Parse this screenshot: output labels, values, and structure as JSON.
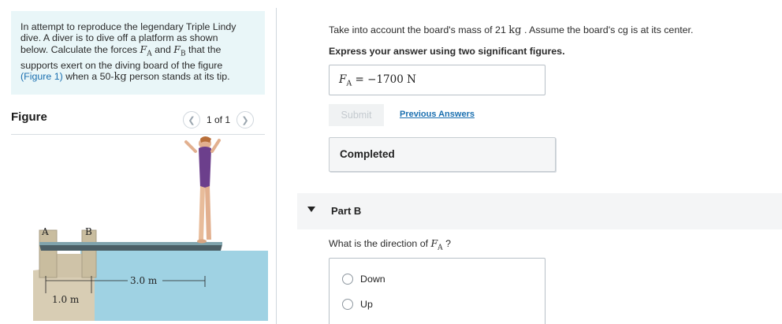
{
  "problem": {
    "line1": "In attempt to reproduce the legendary Triple Lindy",
    "line2": "dive.  A diver is to dive off a platform as shown",
    "line3a": "below.  Calculate the forces ",
    "fa": "F",
    "fa_sub": "A",
    "and": " and ",
    "fb": "F",
    "fb_sub": "B",
    "line3b": " that the",
    "line4": "supports exert on the diving board of the figure",
    "link_open": "(",
    "figure_link": "Figure 1",
    "link_close": ")",
    "line5a": " when a 50-",
    "kg": "kg",
    "line5b": " person stands at its tip."
  },
  "figure": {
    "title": "Figure",
    "pager_text": "1 of 1",
    "label_a": "A",
    "label_b": "B",
    "dim_long": "3.0 m",
    "dim_short": "1.0 m"
  },
  "partA": {
    "prompt_pre": "Take into account the board's mass of 21 ",
    "prompt_kg": "kg",
    "prompt_post": " . Assume the board's cg is at its center.",
    "instruction": "Express your answer using two significant figures.",
    "answer_lhs": "F",
    "answer_sub": "A",
    "answer_eq": " =  ",
    "answer_value": "−1700  N",
    "submit_label": "Submit",
    "prev_answers_label": "Previous Answers",
    "completed_label": "Completed"
  },
  "partB": {
    "label": "Part B",
    "question_pre": "What is the direction of ",
    "q_var": "F",
    "q_sub": "A",
    "question_post": " ?",
    "options": [
      "Down",
      "Up"
    ]
  }
}
